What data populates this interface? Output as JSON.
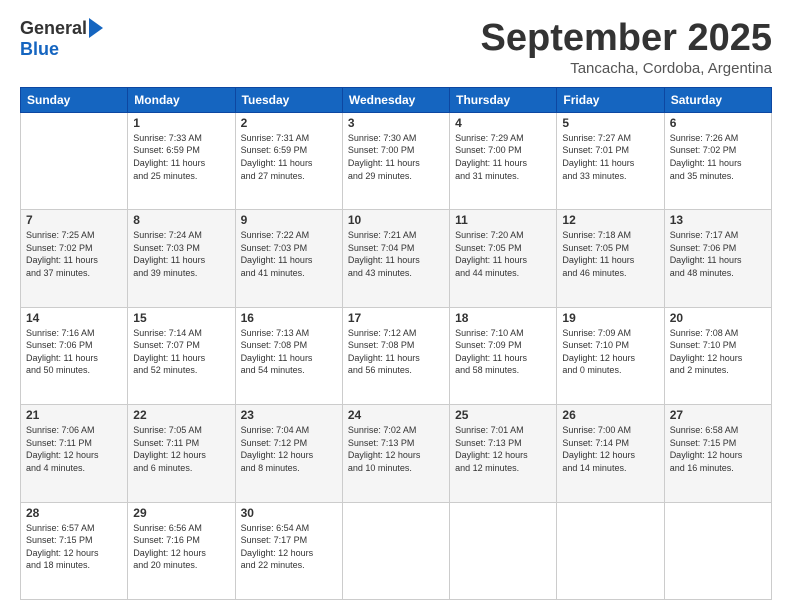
{
  "logo": {
    "general": "General",
    "blue": "Blue"
  },
  "title": "September 2025",
  "subtitle": "Tancacha, Cordoba, Argentina",
  "weekdays": [
    "Sunday",
    "Monday",
    "Tuesday",
    "Wednesday",
    "Thursday",
    "Friday",
    "Saturday"
  ],
  "weeks": [
    [
      {
        "day": "",
        "text": ""
      },
      {
        "day": "1",
        "text": "Sunrise: 7:33 AM\nSunset: 6:59 PM\nDaylight: 11 hours\nand 25 minutes."
      },
      {
        "day": "2",
        "text": "Sunrise: 7:31 AM\nSunset: 6:59 PM\nDaylight: 11 hours\nand 27 minutes."
      },
      {
        "day": "3",
        "text": "Sunrise: 7:30 AM\nSunset: 7:00 PM\nDaylight: 11 hours\nand 29 minutes."
      },
      {
        "day": "4",
        "text": "Sunrise: 7:29 AM\nSunset: 7:00 PM\nDaylight: 11 hours\nand 31 minutes."
      },
      {
        "day": "5",
        "text": "Sunrise: 7:27 AM\nSunset: 7:01 PM\nDaylight: 11 hours\nand 33 minutes."
      },
      {
        "day": "6",
        "text": "Sunrise: 7:26 AM\nSunset: 7:02 PM\nDaylight: 11 hours\nand 35 minutes."
      }
    ],
    [
      {
        "day": "7",
        "text": "Sunrise: 7:25 AM\nSunset: 7:02 PM\nDaylight: 11 hours\nand 37 minutes."
      },
      {
        "day": "8",
        "text": "Sunrise: 7:24 AM\nSunset: 7:03 PM\nDaylight: 11 hours\nand 39 minutes."
      },
      {
        "day": "9",
        "text": "Sunrise: 7:22 AM\nSunset: 7:03 PM\nDaylight: 11 hours\nand 41 minutes."
      },
      {
        "day": "10",
        "text": "Sunrise: 7:21 AM\nSunset: 7:04 PM\nDaylight: 11 hours\nand 43 minutes."
      },
      {
        "day": "11",
        "text": "Sunrise: 7:20 AM\nSunset: 7:05 PM\nDaylight: 11 hours\nand 44 minutes."
      },
      {
        "day": "12",
        "text": "Sunrise: 7:18 AM\nSunset: 7:05 PM\nDaylight: 11 hours\nand 46 minutes."
      },
      {
        "day": "13",
        "text": "Sunrise: 7:17 AM\nSunset: 7:06 PM\nDaylight: 11 hours\nand 48 minutes."
      }
    ],
    [
      {
        "day": "14",
        "text": "Sunrise: 7:16 AM\nSunset: 7:06 PM\nDaylight: 11 hours\nand 50 minutes."
      },
      {
        "day": "15",
        "text": "Sunrise: 7:14 AM\nSunset: 7:07 PM\nDaylight: 11 hours\nand 52 minutes."
      },
      {
        "day": "16",
        "text": "Sunrise: 7:13 AM\nSunset: 7:08 PM\nDaylight: 11 hours\nand 54 minutes."
      },
      {
        "day": "17",
        "text": "Sunrise: 7:12 AM\nSunset: 7:08 PM\nDaylight: 11 hours\nand 56 minutes."
      },
      {
        "day": "18",
        "text": "Sunrise: 7:10 AM\nSunset: 7:09 PM\nDaylight: 11 hours\nand 58 minutes."
      },
      {
        "day": "19",
        "text": "Sunrise: 7:09 AM\nSunset: 7:10 PM\nDaylight: 12 hours\nand 0 minutes."
      },
      {
        "day": "20",
        "text": "Sunrise: 7:08 AM\nSunset: 7:10 PM\nDaylight: 12 hours\nand 2 minutes."
      }
    ],
    [
      {
        "day": "21",
        "text": "Sunrise: 7:06 AM\nSunset: 7:11 PM\nDaylight: 12 hours\nand 4 minutes."
      },
      {
        "day": "22",
        "text": "Sunrise: 7:05 AM\nSunset: 7:11 PM\nDaylight: 12 hours\nand 6 minutes."
      },
      {
        "day": "23",
        "text": "Sunrise: 7:04 AM\nSunset: 7:12 PM\nDaylight: 12 hours\nand 8 minutes."
      },
      {
        "day": "24",
        "text": "Sunrise: 7:02 AM\nSunset: 7:13 PM\nDaylight: 12 hours\nand 10 minutes."
      },
      {
        "day": "25",
        "text": "Sunrise: 7:01 AM\nSunset: 7:13 PM\nDaylight: 12 hours\nand 12 minutes."
      },
      {
        "day": "26",
        "text": "Sunrise: 7:00 AM\nSunset: 7:14 PM\nDaylight: 12 hours\nand 14 minutes."
      },
      {
        "day": "27",
        "text": "Sunrise: 6:58 AM\nSunset: 7:15 PM\nDaylight: 12 hours\nand 16 minutes."
      }
    ],
    [
      {
        "day": "28",
        "text": "Sunrise: 6:57 AM\nSunset: 7:15 PM\nDaylight: 12 hours\nand 18 minutes."
      },
      {
        "day": "29",
        "text": "Sunrise: 6:56 AM\nSunset: 7:16 PM\nDaylight: 12 hours\nand 20 minutes."
      },
      {
        "day": "30",
        "text": "Sunrise: 6:54 AM\nSunset: 7:17 PM\nDaylight: 12 hours\nand 22 minutes."
      },
      {
        "day": "",
        "text": ""
      },
      {
        "day": "",
        "text": ""
      },
      {
        "day": "",
        "text": ""
      },
      {
        "day": "",
        "text": ""
      }
    ]
  ]
}
